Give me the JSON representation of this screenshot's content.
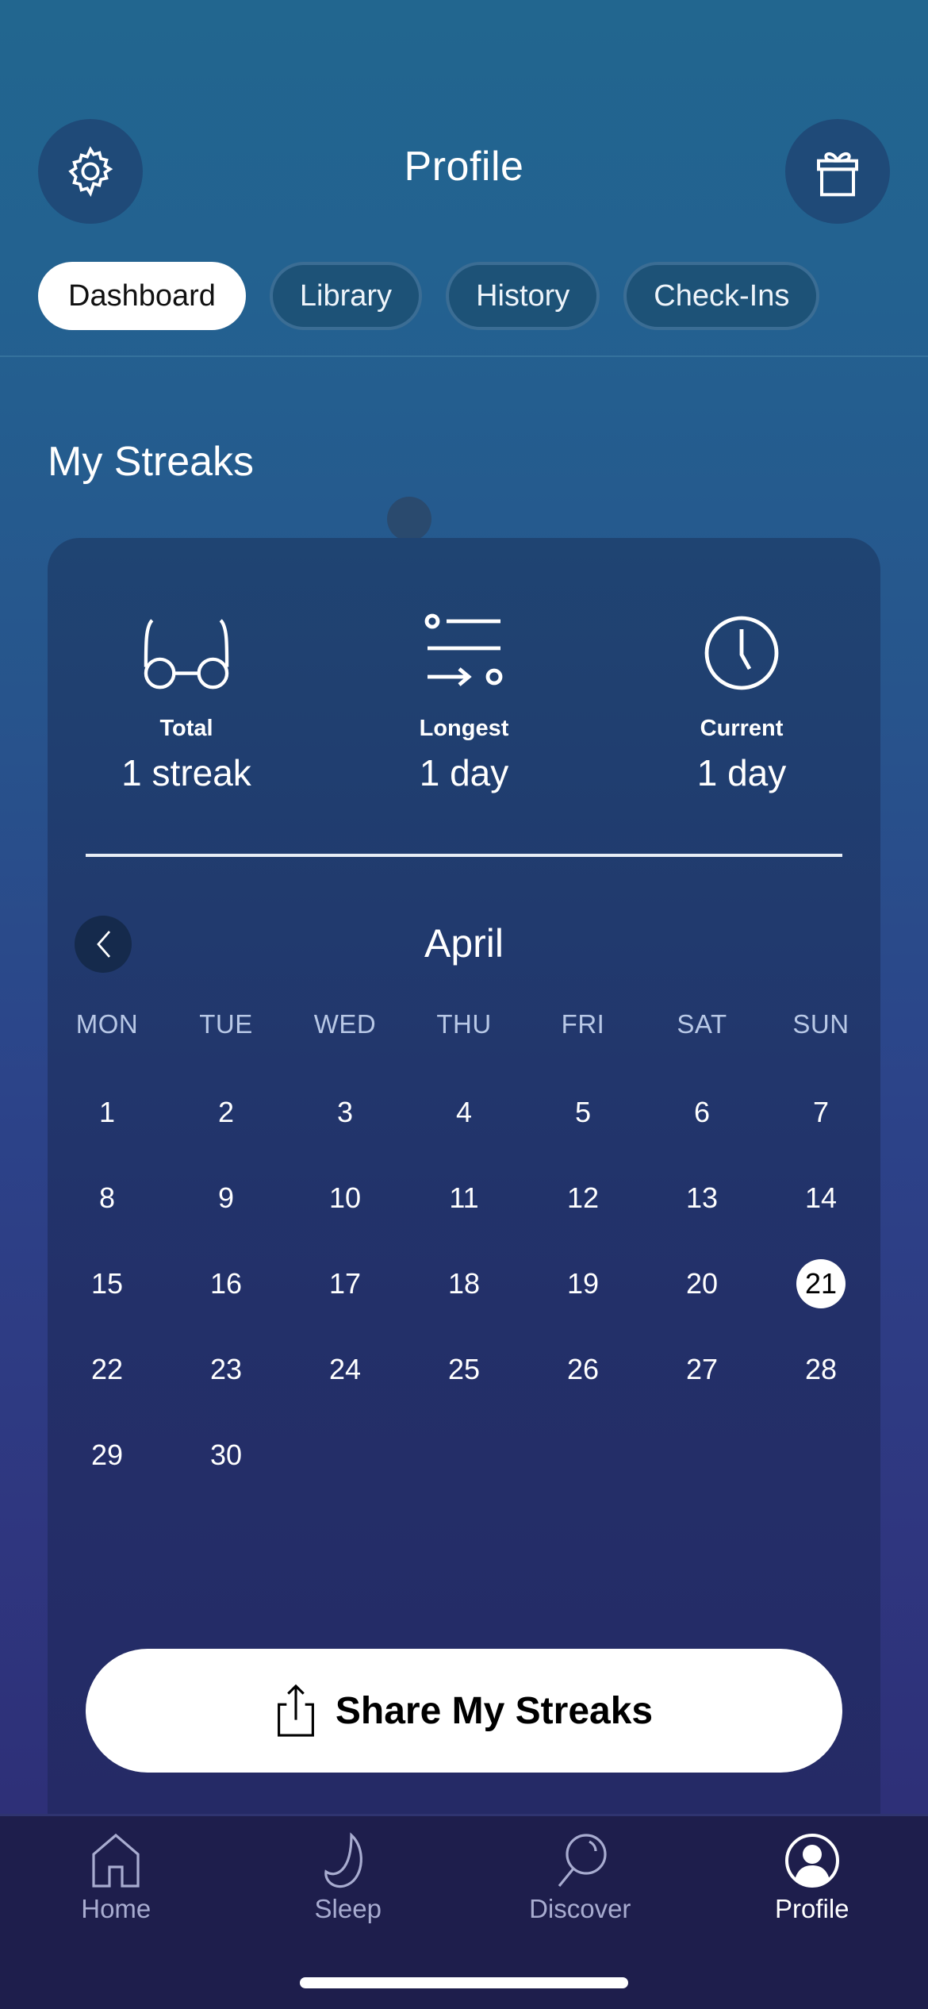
{
  "header": {
    "title": "Profile",
    "left_icon": "gear-icon",
    "right_icon": "gift-icon"
  },
  "tabs": [
    {
      "label": "Dashboard",
      "active": true
    },
    {
      "label": "Library",
      "active": false
    },
    {
      "label": "History",
      "active": false
    },
    {
      "label": "Check-Ins",
      "active": false
    }
  ],
  "streaks": {
    "title": "My Streaks",
    "stats": [
      {
        "icon": "glasses-icon",
        "label": "Total",
        "value": "1 streak"
      },
      {
        "icon": "list-arrow-icon",
        "label": "Longest",
        "value": "1 day"
      },
      {
        "icon": "clock-icon",
        "label": "Current",
        "value": "1 day"
      }
    ]
  },
  "calendar": {
    "month": "April",
    "prev_icon": "chevron-left-icon",
    "weekdays": [
      "MON",
      "TUE",
      "WED",
      "THU",
      "FRI",
      "SAT",
      "SUN"
    ],
    "first_weekday_offset": 0,
    "days": [
      "1",
      "2",
      "3",
      "4",
      "5",
      "6",
      "7",
      "8",
      "9",
      "10",
      "11",
      "12",
      "13",
      "14",
      "15",
      "16",
      "17",
      "18",
      "19",
      "20",
      "21",
      "22",
      "23",
      "24",
      "25",
      "26",
      "27",
      "28",
      "29",
      "30"
    ],
    "today": "21"
  },
  "share": {
    "label": "Share My Streaks",
    "icon": "share-icon"
  },
  "tabbar": [
    {
      "label": "Home",
      "icon": "home-icon",
      "active": false
    },
    {
      "label": "Sleep",
      "icon": "moon-icon",
      "active": false
    },
    {
      "label": "Discover",
      "icon": "search-icon",
      "active": false
    },
    {
      "label": "Profile",
      "icon": "profile-icon",
      "active": true
    }
  ],
  "colors": {
    "accent_active": "#ffffff",
    "inactive_tab_text": "#a8acd0",
    "bg_top": "#22668f",
    "bg_bottom": "#2c2d72"
  }
}
